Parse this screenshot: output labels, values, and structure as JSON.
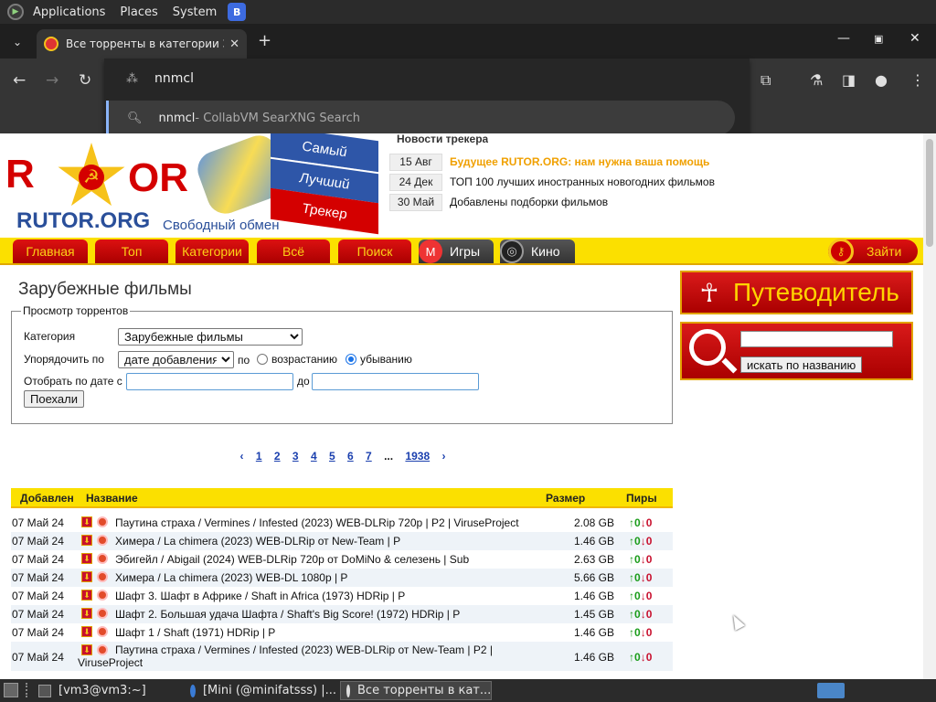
{
  "topbar": {
    "applications": "Applications",
    "places": "Places",
    "system": "System"
  },
  "browser": {
    "tab_title": "Все торренты в категории З",
    "omnibox_query": "nnmcl",
    "suggestion_query": "nnmcl",
    "suggestion_source": " - CollabVM SearXNG Search"
  },
  "site": {
    "logo_left": "R",
    "logo_right": "OR",
    "domain": "RUTOR.ORG",
    "slogan": "Свободный обмен",
    "flag": [
      "Самый",
      "Лучший",
      "Трекер"
    ]
  },
  "news": {
    "heading": "Новости трекера",
    "items": [
      {
        "date": "15 Авг",
        "text": "Будущее RUTOR.ORG: нам нужна ваша помощь",
        "highlight": true
      },
      {
        "date": "24 Дек",
        "text": "ТОП 100 лучших иностранных новогодних фильмов"
      },
      {
        "date": "30 Май",
        "text": "Добавлены подборки фильмов"
      }
    ]
  },
  "menu": {
    "home": "Главная",
    "top": "Топ",
    "categories": "Категории",
    "all": "Всё",
    "search": "Поиск",
    "games": "Игры",
    "cinema": "Кино",
    "login": "Зайти"
  },
  "page_title": "Зарубежные фильмы",
  "filter": {
    "legend": "Просмотр торрентов",
    "category_label": "Категория",
    "category_value": "Зарубежные фильмы",
    "sort_label": "Упорядочить по",
    "sort_value": "дате добавления",
    "by": "по",
    "asc": "возрастанию",
    "desc": "убыванию",
    "date_label": "Отобрать по дате с",
    "to": "до",
    "go": "Поехали"
  },
  "pager": {
    "prev": "‹",
    "pages": [
      "1",
      "2",
      "3",
      "4",
      "5",
      "6",
      "7"
    ],
    "ellipsis": "...",
    "last": "1938",
    "next": "›"
  },
  "table": {
    "headers": {
      "added": "Добавлен",
      "name": "Название",
      "size": "Размер",
      "peers": "Пиры"
    },
    "rows": [
      {
        "date": "07 Май 24",
        "name": "Паутина страха / Vermines / Infested (2023) WEB-DLRip 720p | P2 | ViruseProject",
        "size": "2.08 GB",
        "seeds": "0",
        "leech": "0"
      },
      {
        "date": "07 Май 24",
        "name": "Химера / La chimera (2023) WEB-DLRip от New-Team | P",
        "size": "1.46 GB",
        "seeds": "0",
        "leech": "0"
      },
      {
        "date": "07 Май 24",
        "name": "Эбигейл / Abigail (2024) WEB-DLRip 720p от DoMiNo & селезень | Sub",
        "size": "2.63 GB",
        "seeds": "0",
        "leech": "0"
      },
      {
        "date": "07 Май 24",
        "name": "Химера / La chimera (2023) WEB-DL 1080p | P",
        "size": "5.66 GB",
        "seeds": "0",
        "leech": "0"
      },
      {
        "date": "07 Май 24",
        "name": "Шафт 3. Шафт в Африке / Shaft in Africa (1973) HDRip | P",
        "size": "1.46 GB",
        "seeds": "0",
        "leech": "0"
      },
      {
        "date": "07 Май 24",
        "name": "Шафт 2. Большая удача Шафта / Shaft's Big Score! (1972) HDRip | P",
        "size": "1.45 GB",
        "seeds": "0",
        "leech": "0"
      },
      {
        "date": "07 Май 24",
        "name": "Шафт 1 / Shaft (1971) HDRip | P",
        "size": "1.46 GB",
        "seeds": "0",
        "leech": "0"
      },
      {
        "date": "07 Май 24",
        "name": "Паутина страха / Vermines / Infested (2023) WEB-DLRip от New-Team | P2 |",
        "name2": "ViruseProject",
        "size": "1.46 GB",
        "seeds": "0",
        "leech": "0"
      }
    ]
  },
  "sidebar": {
    "guide": "Путеводитель",
    "search_button": "искать по названию"
  },
  "taskbar": {
    "tasks": [
      "[vm3@vm3:~]",
      "[Mini (@minifatsss) |...",
      "Все торренты в кат..."
    ]
  },
  "colors": {
    "menu_yellow": "#fbe000",
    "menu_red": "#c00000",
    "news_highlight": "#f0a000",
    "link_blue": "#1a3fae"
  }
}
